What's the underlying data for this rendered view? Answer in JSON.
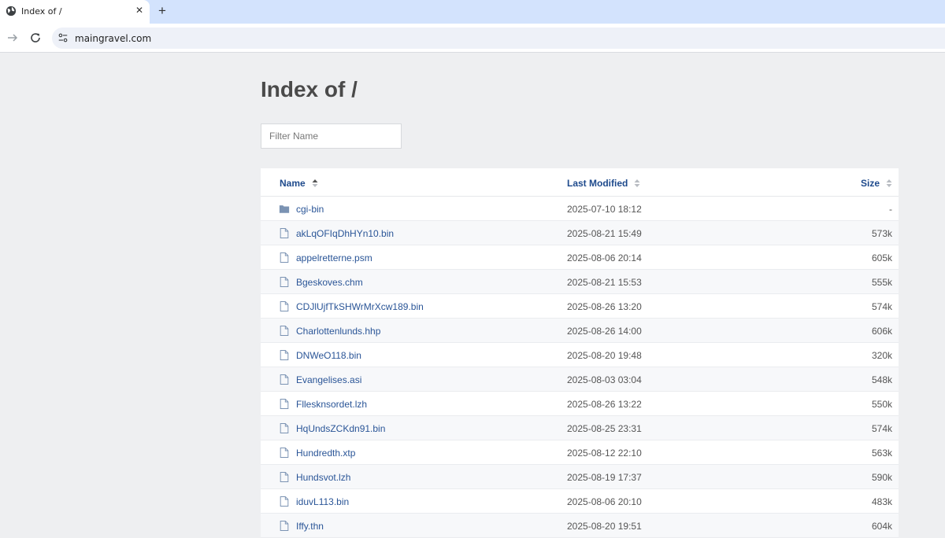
{
  "browser": {
    "tab_title": "Index of /",
    "close_glyph": "✕",
    "newtab_glyph": "+",
    "url": "maingravel.com"
  },
  "page": {
    "heading": "Index of /",
    "filter_placeholder": "Filter Name"
  },
  "table": {
    "headers": {
      "name": "Name",
      "modified": "Last Modified",
      "size": "Size"
    },
    "rows": [
      {
        "type": "folder",
        "name": "cgi-bin",
        "modified": "2025-07-10 18:12",
        "size": "-"
      },
      {
        "type": "file",
        "name": "akLqOFIqDhHYn10.bin",
        "modified": "2025-08-21 15:49",
        "size": "573k"
      },
      {
        "type": "file",
        "name": "appelretterne.psm",
        "modified": "2025-08-06 20:14",
        "size": "605k"
      },
      {
        "type": "file",
        "name": "Bgeskoves.chm",
        "modified": "2025-08-21 15:53",
        "size": "555k"
      },
      {
        "type": "file",
        "name": "CDJlUjfTkSHWrMrXcw189.bin",
        "modified": "2025-08-26 13:20",
        "size": "574k"
      },
      {
        "type": "file",
        "name": "Charlottenlunds.hhp",
        "modified": "2025-08-26 14:00",
        "size": "606k"
      },
      {
        "type": "file",
        "name": "DNWeO118.bin",
        "modified": "2025-08-20 19:48",
        "size": "320k"
      },
      {
        "type": "file",
        "name": "Evangelises.asi",
        "modified": "2025-08-03 03:04",
        "size": "548k"
      },
      {
        "type": "file",
        "name": "Fllesknsordet.lzh",
        "modified": "2025-08-26 13:22",
        "size": "550k"
      },
      {
        "type": "file",
        "name": "HqUndsZCKdn91.bin",
        "modified": "2025-08-25 23:31",
        "size": "574k"
      },
      {
        "type": "file",
        "name": "Hundredth.xtp",
        "modified": "2025-08-12 22:10",
        "size": "563k"
      },
      {
        "type": "file",
        "name": "Hundsvot.lzh",
        "modified": "2025-08-19 17:37",
        "size": "590k"
      },
      {
        "type": "file",
        "name": "iduvL113.bin",
        "modified": "2025-08-06 20:10",
        "size": "483k"
      },
      {
        "type": "file",
        "name": "Iffy.thn",
        "modified": "2025-08-20 19:51",
        "size": "604k"
      }
    ]
  }
}
